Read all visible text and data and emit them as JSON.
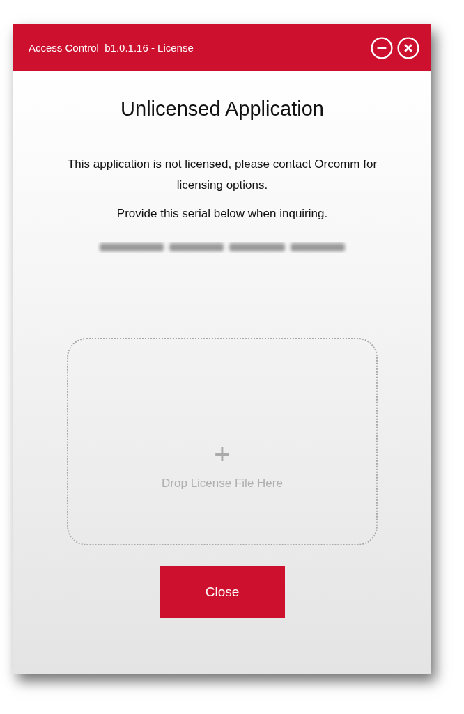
{
  "window": {
    "title": "Access Control  b1.0.1.16 - License"
  },
  "heading": "Unlicensed Application",
  "message": "This application is not licensed, please contact Orcomm for licensing options.",
  "instruction": "Provide this serial below when inquiring.",
  "drop_zone": {
    "icon": "+",
    "label": "Drop License File Here"
  },
  "buttons": [
    "Close"
  ]
}
